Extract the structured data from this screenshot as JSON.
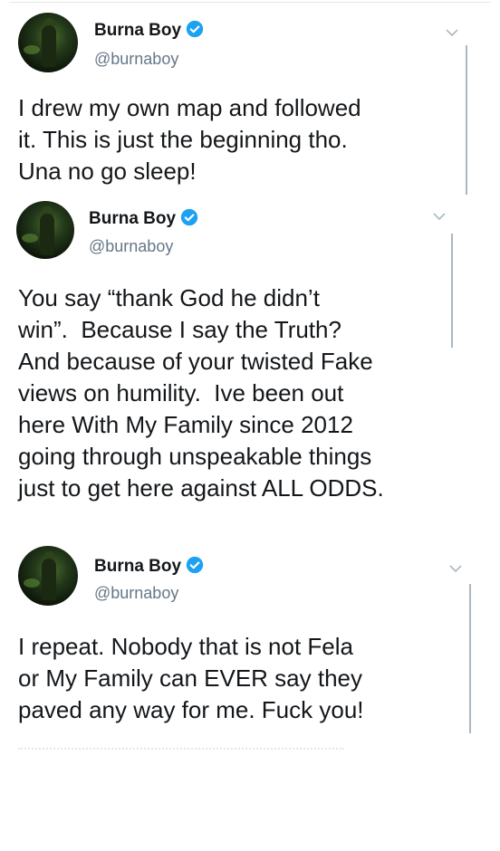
{
  "tweets": [
    {
      "name": "Burna Boy",
      "handle": "@burnaboy",
      "text": "I drew my own map and followed\nit. This is just the beginning tho.\nUna no go sleep!"
    },
    {
      "name": "Burna Boy",
      "handle": "@burnaboy",
      "text": "You say “thank God he didn’t\nwin”.  Because I say the Truth?\nAnd because of your twisted Fake\nviews on humility.  Ive been out\nhere With My Family since 2012\ngoing through unspeakable things\njust to get here against ALL ODDS."
    },
    {
      "name": "Burna Boy",
      "handle": "@burnaboy",
      "text": "I repeat. Nobody that is not Fela\nor My Family can EVER say they\npaved any way for me. Fuck you!"
    }
  ],
  "icons": {
    "avatar": "profile-photo",
    "verified": "verified-badge-icon",
    "menu": "chevron-down-icon"
  },
  "colors": {
    "verified": "#1da1f2",
    "handle": "#657786",
    "text": "#14171a",
    "divider": "#aab8c2"
  }
}
